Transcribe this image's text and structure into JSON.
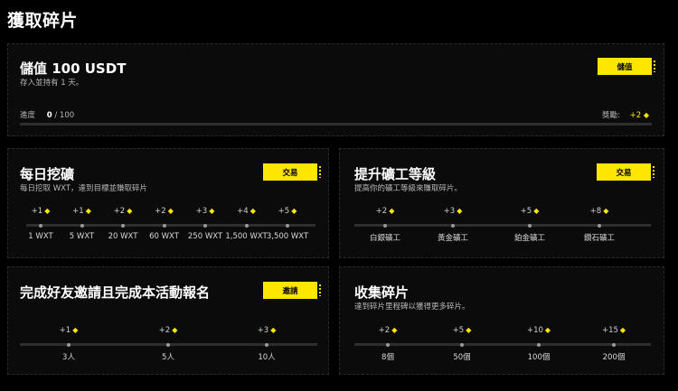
{
  "page_title": "獲取碎片",
  "colors": {
    "accent": "#ffe600",
    "background": "#000000",
    "card": "#0b0b0b"
  },
  "deposit": {
    "title": "儲值 100 USDT",
    "subtitle": "存入並持有 1 天。",
    "button": "儲值",
    "progress_label": "進度",
    "progress_current": "0",
    "progress_total": "/ 100",
    "progress_value": 0,
    "reward_label": "獎勵:",
    "reward_value": "+2"
  },
  "daily_mining": {
    "title": "每日挖礦",
    "subtitle": "每日挖取 WXT，達到目標並賺取碎片",
    "button": "交易",
    "rewards": [
      "+1",
      "+1",
      "+2",
      "+2",
      "+3",
      "+4",
      "+5"
    ],
    "ticks": [
      "1 WXT",
      "5 WXT",
      "20 WXT",
      "60 WXT",
      "250 WXT",
      "1,500 WXT",
      "3,500 WXT"
    ]
  },
  "miner_level": {
    "title": "提升礦工等級",
    "subtitle": "提高你的礦工等級來賺取碎片。",
    "button": "交易",
    "rewards": [
      "+2",
      "+3",
      "+5",
      "+8"
    ],
    "ticks": [
      "白銀礦工",
      "黃金礦工",
      "鉑金礦工",
      "鑽石礦工"
    ]
  },
  "invite": {
    "title": "完成好友邀請且完成本活動報名",
    "button": "邀請",
    "rewards": [
      "+1",
      "+2",
      "+3"
    ],
    "ticks": [
      "3人",
      "5人",
      "10人"
    ]
  },
  "collect": {
    "title": "收集碎片",
    "subtitle": "達到碎片里程碑以獲得更多碎片。",
    "rewards": [
      "+2",
      "+5",
      "+10",
      "+15"
    ],
    "ticks": [
      "8個",
      "50個",
      "100個",
      "200個"
    ]
  }
}
